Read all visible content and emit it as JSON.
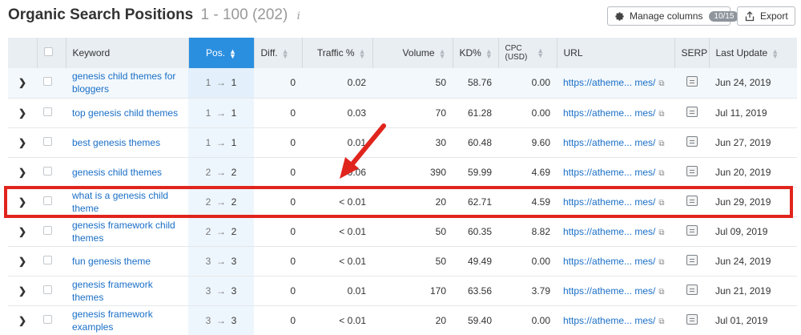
{
  "header": {
    "title": "Organic Search Positions",
    "range": "1 - 100 (202)",
    "info_glyph": "i",
    "manage_columns_label": "Manage columns",
    "manage_columns_badge": "10/15",
    "export_label": "Export"
  },
  "columns": {
    "keyword": "Keyword",
    "pos": "Pos.",
    "diff": "Diff.",
    "traffic": "Traffic %",
    "volume": "Volume",
    "kd": "KD%",
    "cpc_line1": "CPC",
    "cpc_line2": "(USD)",
    "url": "URL",
    "serp": "SERP",
    "last_update": "Last Update"
  },
  "rows": [
    {
      "keyword": "genesis child themes for bloggers",
      "pos_from": "1",
      "pos_to": "1",
      "diff": "0",
      "traffic": "0.02",
      "volume": "50",
      "kd": "58.76",
      "cpc": "0.00",
      "url": "https://atheme... mes/",
      "last_update": "Jun 24, 2019"
    },
    {
      "keyword": "top genesis child themes",
      "pos_from": "1",
      "pos_to": "1",
      "diff": "0",
      "traffic": "0.03",
      "volume": "70",
      "kd": "61.28",
      "cpc": "0.00",
      "url": "https://atheme... mes/",
      "last_update": "Jul 11, 2019"
    },
    {
      "keyword": "best genesis themes",
      "pos_from": "1",
      "pos_to": "1",
      "diff": "0",
      "traffic": "0.01",
      "volume": "30",
      "kd": "60.48",
      "cpc": "9.60",
      "url": "https://atheme... mes/",
      "last_update": "Jun 27, 2019"
    },
    {
      "keyword": "genesis child themes",
      "pos_from": "2",
      "pos_to": "2",
      "diff": "0",
      "traffic": "0.06",
      "volume": "390",
      "kd": "59.99",
      "cpc": "4.69",
      "url": "https://atheme... mes/",
      "last_update": "Jun 20, 2019"
    },
    {
      "keyword": "what is a genesis child theme",
      "pos_from": "2",
      "pos_to": "2",
      "diff": "0",
      "traffic": "< 0.01",
      "volume": "20",
      "kd": "62.71",
      "cpc": "4.59",
      "url": "https://atheme... mes/",
      "last_update": "Jun 29, 2019"
    },
    {
      "keyword": "genesis framework child themes",
      "pos_from": "2",
      "pos_to": "2",
      "diff": "0",
      "traffic": "< 0.01",
      "volume": "50",
      "kd": "60.35",
      "cpc": "8.82",
      "url": "https://atheme... mes/",
      "last_update": "Jul 09, 2019"
    },
    {
      "keyword": "fun genesis theme",
      "pos_from": "3",
      "pos_to": "3",
      "diff": "0",
      "traffic": "< 0.01",
      "volume": "50",
      "kd": "49.49",
      "cpc": "0.00",
      "url": "https://atheme... mes/",
      "last_update": "Jun 24, 2019"
    },
    {
      "keyword": "genesis framework themes",
      "pos_from": "3",
      "pos_to": "3",
      "diff": "0",
      "traffic": "0.01",
      "volume": "170",
      "kd": "63.56",
      "cpc": "3.79",
      "url": "https://atheme... mes/",
      "last_update": "Jun 21, 2019"
    },
    {
      "keyword": "genesis framework examples",
      "pos_from": "3",
      "pos_to": "3",
      "diff": "0",
      "traffic": "< 0.01",
      "volume": "20",
      "kd": "59.40",
      "cpc": "0.00",
      "url": "https://atheme... mes/",
      "last_update": "Jul 01, 2019"
    }
  ],
  "annotation": {
    "highlight_color": "#e0251d",
    "highlighted_row_keyword": "what is a genesis child theme"
  },
  "colors": {
    "accent": "#2b8fe0",
    "link": "#1a6fc7"
  }
}
